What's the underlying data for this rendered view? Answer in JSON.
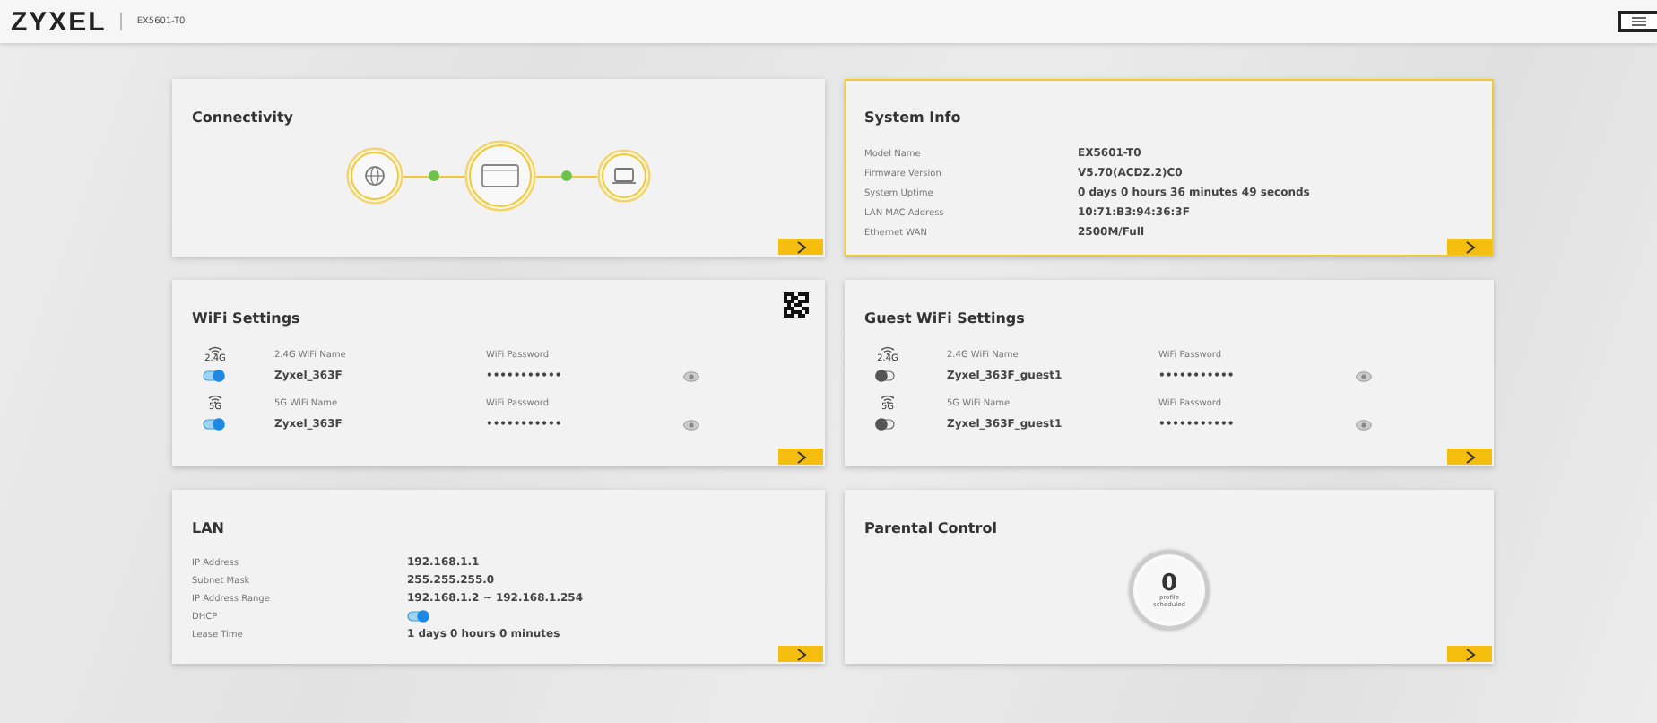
{
  "header": {
    "brand": "ZYXEL",
    "model": "EX5601-T0"
  },
  "connectivity": {
    "title": "Connectivity",
    "links": [
      {
        "connected": true
      },
      {
        "connected": true
      }
    ]
  },
  "system_info": {
    "title": "System Info",
    "highlighted": true,
    "rows": [
      {
        "label": "Model Name",
        "value": "EX5601-T0"
      },
      {
        "label": "Firmware Version",
        "value": "V5.70(ACDZ.2)C0"
      },
      {
        "label": "System Uptime",
        "value": "0 days 0 hours 36 minutes 49 seconds"
      },
      {
        "label": "LAN MAC Address",
        "value": "10:71:B3:94:36:3F"
      },
      {
        "label": "Ethernet WAN",
        "value": "2500M/Full"
      }
    ]
  },
  "wifi": {
    "title": "WiFi Settings",
    "networks": [
      {
        "band": "2.4G",
        "name_label": "2.4G WiFi Name",
        "name": "Zyxel_363F",
        "password_label": "WiFi Password",
        "password": "•••••••••••",
        "on": true
      },
      {
        "band": "5G",
        "name_label": "5G WiFi Name",
        "name": "Zyxel_363F",
        "password_label": "WiFi Password",
        "password": "•••••••••••",
        "on": true
      }
    ]
  },
  "guest_wifi": {
    "title": "Guest WiFi Settings",
    "networks": [
      {
        "band": "2.4G",
        "name_label": "2.4G WiFi Name",
        "name": "Zyxel_363F_guest1",
        "password_label": "WiFi Password",
        "password": "•••••••••••",
        "on": false
      },
      {
        "band": "5G",
        "name_label": "5G WiFi Name",
        "name": "Zyxel_363F_guest1",
        "password_label": "WiFi Password",
        "password": "•••••••••••",
        "on": false
      }
    ]
  },
  "lan": {
    "title": "LAN",
    "rows": [
      {
        "kind": "text",
        "label": "IP Address",
        "value": "192.168.1.1"
      },
      {
        "kind": "text",
        "label": "Subnet Mask",
        "value": "255.255.255.0"
      },
      {
        "kind": "text",
        "label": "IP Address Range",
        "value": "192.168.1.2 ~ 192.168.1.254"
      },
      {
        "kind": "toggle",
        "label": "DHCP",
        "on": true
      },
      {
        "kind": "text",
        "label": "Lease Time",
        "value": "1 days 0 hours 0 minutes"
      }
    ]
  },
  "parental_control": {
    "title": "Parental Control",
    "count": "0",
    "caption": "profile scheduled"
  }
}
